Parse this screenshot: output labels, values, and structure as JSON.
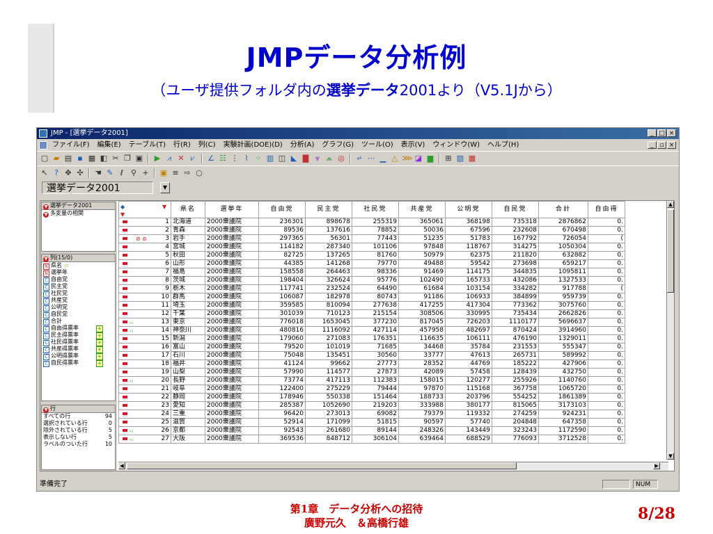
{
  "slide": {
    "title": "JMPデータ分析例",
    "subtitle_pre": "（ユーザ提供フォルダ内の",
    "subtitle_bold": "選挙データ",
    "subtitle_post": "2001より（V5.1Jから）",
    "footer_line1": "第1章　データ分析への招待",
    "footer_line2": "廣野元久　＆高橋行雄",
    "page": "8/28"
  },
  "window": {
    "title": "JMP - [選挙データ2001]",
    "menu": [
      "ファイル(F)",
      "編集(E)",
      "テーブル(T)",
      "行(R)",
      "列(C)",
      "実験計画(DOE)(D)",
      "分析(A)",
      "グラフ(G)",
      "ツール(O)",
      "表示(V)",
      "ウィンドウ(W)",
      "ヘルプ(H)"
    ],
    "table_selector": "選挙データ2001",
    "status": "準備完了",
    "num_indicator": "NUM"
  },
  "panel": {
    "table_head": "選挙データ2001",
    "script_item": "多変量の相関",
    "columns_head": "列(15/0)",
    "columns": [
      {
        "name": "県名",
        "type": "N"
      },
      {
        "name": "選挙年",
        "type": "N"
      },
      {
        "name": "自由党",
        "type": "C"
      },
      {
        "name": "民主党",
        "type": "C"
      },
      {
        "name": "社民党",
        "type": "C"
      },
      {
        "name": "共産党",
        "type": "C"
      },
      {
        "name": "公明党",
        "type": "C"
      },
      {
        "name": "自民党",
        "type": "C"
      },
      {
        "name": "合計",
        "type": "C"
      },
      {
        "name": "自由得票率",
        "type": "C"
      },
      {
        "name": "民主得票率",
        "type": "C"
      },
      {
        "name": "社民得票率",
        "type": "C"
      },
      {
        "name": "共産得票率",
        "type": "C"
      },
      {
        "name": "公明得票率",
        "type": "C"
      },
      {
        "name": "自民得票率",
        "type": "C"
      }
    ],
    "rows_head": "行",
    "row_stats": [
      {
        "label": "すべての行",
        "value": "94"
      },
      {
        "label": "選択されている行",
        "value": "0"
      },
      {
        "label": "除外されている行",
        "value": "5"
      },
      {
        "label": "表示しない行",
        "value": "5"
      },
      {
        "label": "ラベルのついた行",
        "value": "10"
      }
    ]
  },
  "grid": {
    "headers": [
      "県名",
      "選挙年",
      "自由党",
      "民主党",
      "社民党",
      "共産党",
      "公明党",
      "自民党",
      "合計",
      "自由得"
    ],
    "rows": [
      [
        "1",
        "北海道",
        "2000衆議院",
        "236301",
        "898678",
        "255319",
        "365061",
        "368198",
        "735318",
        "2876862",
        "0."
      ],
      [
        "2",
        "青森",
        "2000衆議院",
        "89536",
        "137616",
        "78852",
        "50036",
        "67596",
        "232608",
        "670498",
        "0."
      ],
      [
        "3",
        "岩手",
        "2000衆議院",
        "297365",
        "56301",
        "77443",
        "51235",
        "51783",
        "167792",
        "726054",
        "("
      ],
      [
        "4",
        "宮城",
        "2000衆議院",
        "114182",
        "287340",
        "101106",
        "97848",
        "118767",
        "314275",
        "1050304",
        "0."
      ],
      [
        "5",
        "秋田",
        "2000衆議院",
        "82725",
        "137265",
        "81760",
        "50979",
        "62375",
        "211820",
        "632882",
        "0."
      ],
      [
        "6",
        "山形",
        "2000衆議院",
        "44385",
        "141268",
        "79770",
        "49488",
        "59542",
        "273698",
        "659217",
        "0."
      ],
      [
        "7",
        "福島",
        "2000衆議院",
        "158558",
        "264463",
        "98336",
        "91469",
        "114175",
        "344835",
        "1095811",
        "0."
      ],
      [
        "8",
        "茨城",
        "2000衆議院",
        "198404",
        "326624",
        "95776",
        "102490",
        "165733",
        "432086",
        "1327533",
        "0."
      ],
      [
        "9",
        "栃木",
        "2000衆議院",
        "117741",
        "232524",
        "64490",
        "61684",
        "103154",
        "334282",
        "917788",
        "("
      ],
      [
        "10",
        "群馬",
        "2000衆議院",
        "106087",
        "182978",
        "80743",
        "91186",
        "106933",
        "384899",
        "959739",
        "0."
      ],
      [
        "11",
        "埼玉",
        "2000衆議院",
        "359585",
        "810094",
        "277638",
        "417255",
        "417304",
        "773362",
        "3075760",
        "0."
      ],
      [
        "12",
        "千葉",
        "2000衆議院",
        "301039",
        "710123",
        "215154",
        "308506",
        "330995",
        "735434",
        "2662826",
        "0."
      ],
      [
        "13",
        "東京",
        "2000衆議院",
        "776018",
        "1653045",
        "377230",
        "817045",
        "726203",
        "1110177",
        "5696637",
        "0."
      ],
      [
        "14",
        "神奈川",
        "2000衆議院",
        "480816",
        "1116092",
        "427114",
        "457958",
        "482697",
        "870424",
        "3914960",
        "0."
      ],
      [
        "15",
        "新潟",
        "2000衆議院",
        "179060",
        "271083",
        "176351",
        "116635",
        "106111",
        "476190",
        "1329011",
        "0."
      ],
      [
        "16",
        "富山",
        "2000衆議院",
        "79520",
        "101019",
        "71685",
        "34468",
        "35784",
        "231553",
        "555347",
        "0."
      ],
      [
        "17",
        "石川",
        "2000衆議院",
        "75048",
        "135451",
        "30560",
        "33777",
        "47613",
        "265731",
        "589992",
        "0."
      ],
      [
        "18",
        "福井",
        "2000衆議院",
        "41124",
        "99662",
        "27773",
        "28352",
        "44769",
        "185222",
        "427906",
        "0."
      ],
      [
        "19",
        "山梨",
        "2000衆議院",
        "57990",
        "114577",
        "27873",
        "42089",
        "57458",
        "128439",
        "432750",
        "0."
      ],
      [
        "20",
        "長野",
        "2000衆議院",
        "73774",
        "417113",
        "112383",
        "158015",
        "120277",
        "255926",
        "1140760",
        "0."
      ],
      [
        "21",
        "岐阜",
        "2000衆議院",
        "122400",
        "275229",
        "79444",
        "97870",
        "115168",
        "367758",
        "1065720",
        "0."
      ],
      [
        "22",
        "静岡",
        "2000衆議院",
        "178946",
        "550338",
        "151464",
        "188733",
        "203796",
        "554252",
        "1861389",
        "0."
      ],
      [
        "23",
        "愛知",
        "2000衆議院",
        "285387",
        "1052690",
        "219203",
        "333988",
        "380177",
        "815065",
        "3173103",
        "0."
      ],
      [
        "24",
        "三重",
        "2000衆議院",
        "96420",
        "273013",
        "69082",
        "79379",
        "119332",
        "274259",
        "924231",
        "0."
      ],
      [
        "25",
        "滋賀",
        "2000衆議院",
        "52914",
        "171099",
        "51815",
        "90597",
        "57740",
        "204848",
        "647358",
        "0."
      ],
      [
        "26",
        "京都",
        "2000衆議院",
        "92543",
        "261680",
        "89144",
        "248326",
        "143449",
        "323243",
        "1172590",
        "0."
      ],
      [
        "27",
        "大阪",
        "2000衆議院",
        "369536",
        "848712",
        "306104",
        "639464",
        "688529",
        "776093",
        "3712528",
        "0."
      ]
    ],
    "labeled_rows": [
      13,
      14,
      20,
      26,
      27
    ],
    "excluded_rows": [
      3
    ]
  }
}
